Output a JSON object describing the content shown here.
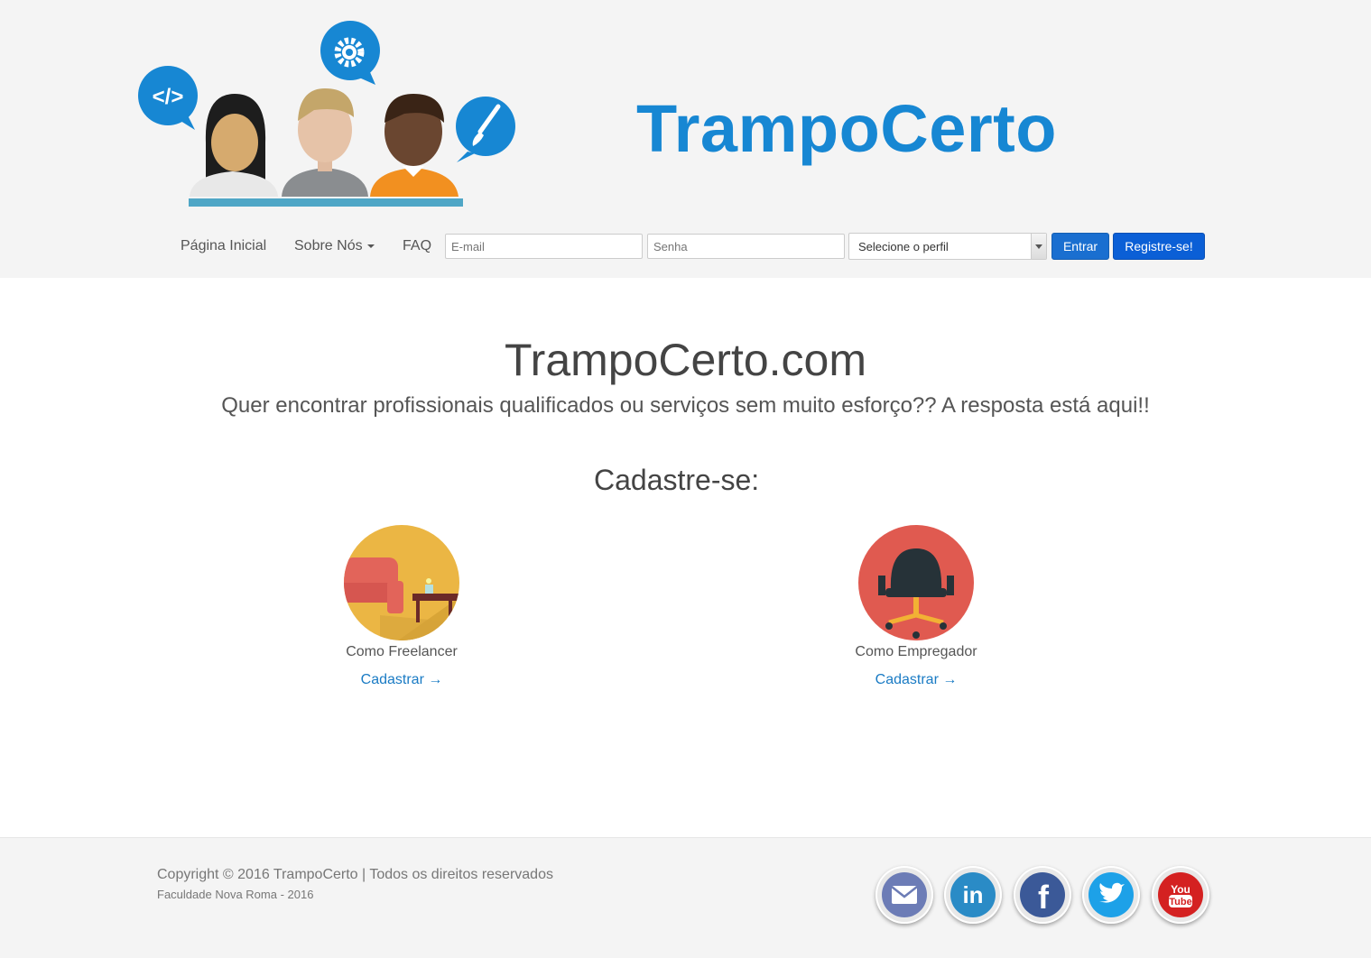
{
  "header": {
    "brand": "TrampoCerto"
  },
  "nav": {
    "home": "Página Inicial",
    "about": "Sobre Nós",
    "faq": "FAQ",
    "email_placeholder": "E-mail",
    "password_placeholder": "Senha",
    "profile_select": "Selecione o perfil",
    "login_button": "Entrar",
    "register_button": "Registre-se!"
  },
  "main": {
    "site_title": "TrampoCerto.com",
    "subtitle": "Quer encontrar profissionais qualificados ou serviços sem muito esforço?? A resposta está aqui!!",
    "signup_heading": "Cadastre-se:",
    "cards": [
      {
        "label": "Como Freelancer",
        "link": "Cadastrar →"
      },
      {
        "label": "Como Empregador",
        "link": "Cadastrar →"
      }
    ]
  },
  "footer": {
    "copyright": "Copyright © 2016 TrampoCerto | Todos os direitos reservados",
    "faculty": "Faculdade Nova Roma - 2016",
    "social": [
      "email-icon",
      "linkedin-icon",
      "facebook-icon",
      "twitter-icon",
      "youtube-icon"
    ]
  },
  "colors": {
    "brand": "#1787d3",
    "primary_button": "#1a6fd0",
    "link": "#1a7bc4",
    "header_bg": "#f4f4f4"
  }
}
